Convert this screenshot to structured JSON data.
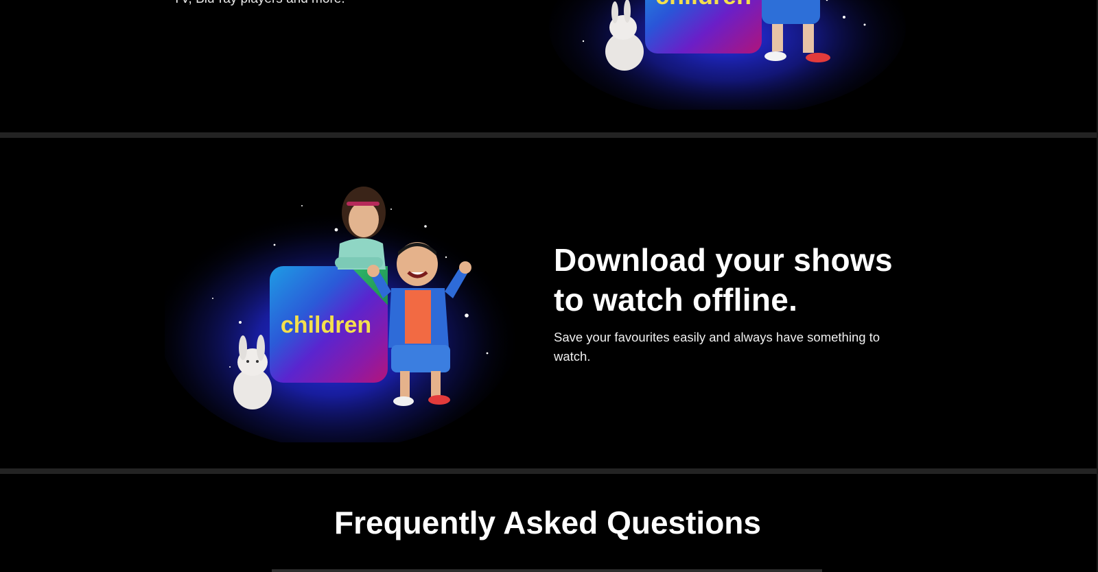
{
  "top_section": {
    "text_fragment": "TV, Blu-ray players and more.",
    "art_label": "children"
  },
  "download_section": {
    "title_line1": "Download your shows",
    "title_line2": "to watch offline.",
    "description": "Save your favourites easily and always have something to watch.",
    "art_label": "children"
  },
  "faq": {
    "title": "Frequently Asked Questions"
  },
  "colors": {
    "background": "#000000",
    "divider": "#232323",
    "label_yellow": "#f4e04d",
    "glow_blue": "#1f2cff"
  }
}
